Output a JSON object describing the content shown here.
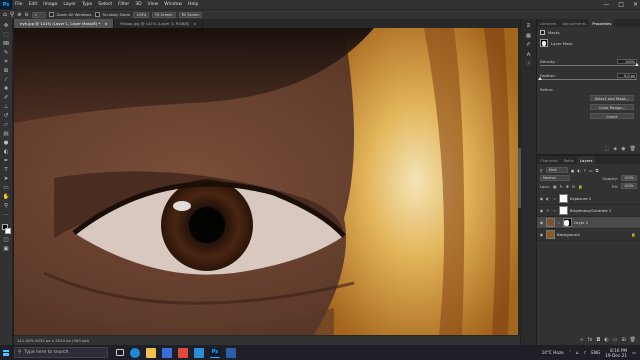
{
  "app": {
    "logo": "Ps"
  },
  "menu": [
    "File",
    "Edit",
    "Image",
    "Layer",
    "Type",
    "Select",
    "Filter",
    "3D",
    "View",
    "Window",
    "Help"
  ],
  "window_controls": {
    "minimize": "—",
    "maximize": "□",
    "close": "✕"
  },
  "options_bar": {
    "size_value": "2",
    "zoom_all_windows": "Zoom All Windows",
    "scrubby_zoom": "Scrubby Zoom",
    "zoom_pct": "100%",
    "fit_screen": "Fit Screen",
    "fill_screen": "Fill Screen"
  },
  "tabs": [
    {
      "label": "eye.jpg @ 141% (Layer 1, Layer Mask/8) *",
      "close": "×"
    },
    {
      "label": "Mskop.jpg @ 141% (Layer 1, RGB/8)",
      "close": "×"
    }
  ],
  "status_bar": "141.42%   4032 px x 3024 px (300 ppi)",
  "properties": {
    "tabs": [
      "Libraries",
      "Adjustments",
      "Properties"
    ],
    "title": "Masks",
    "layer_mask_label": "Layer Mask",
    "density_label": "Density:",
    "density_value": "100%",
    "feather_label": "Feather:",
    "feather_value": "0.0 px",
    "refine_label": "Refine:",
    "select_and_mask": "Select and Mask...",
    "color_range": "Color Range...",
    "invert": "Invert",
    "density_fraction": 1.0,
    "feather_fraction": 0.0
  },
  "layers_panel": {
    "tabs": [
      "Channels",
      "Paths",
      "Layers"
    ],
    "kind_label": "Kind",
    "blend_mode": "Normal",
    "opacity_label": "Opacity:",
    "opacity_value": "100%",
    "lock_label": "Lock:",
    "fill_label": "Fill:",
    "fill_value": "100%",
    "layers": [
      {
        "name": "Exposure 1",
        "thumb": "#ffffff",
        "selected": false
      },
      {
        "name": "Brightness/Contrast 1",
        "thumb": "#ffffff",
        "selected": false
      },
      {
        "name": "Layer 1",
        "thumb": "#7a5236",
        "selected": true
      },
      {
        "name": "Background",
        "thumb": "#8a5a2a",
        "selected": false
      }
    ]
  },
  "taskbar": {
    "search_placeholder": "Type here to search",
    "weather": "14°C  Haze",
    "lang": "ENG",
    "time": "8:16 PM",
    "date": "19-Dec-21"
  },
  "colors": {
    "accent": "#31a8ff",
    "panel_bg": "#323232",
    "app_bg": "#1e1e1e",
    "taskbar_bg": "#1f1f2a"
  }
}
